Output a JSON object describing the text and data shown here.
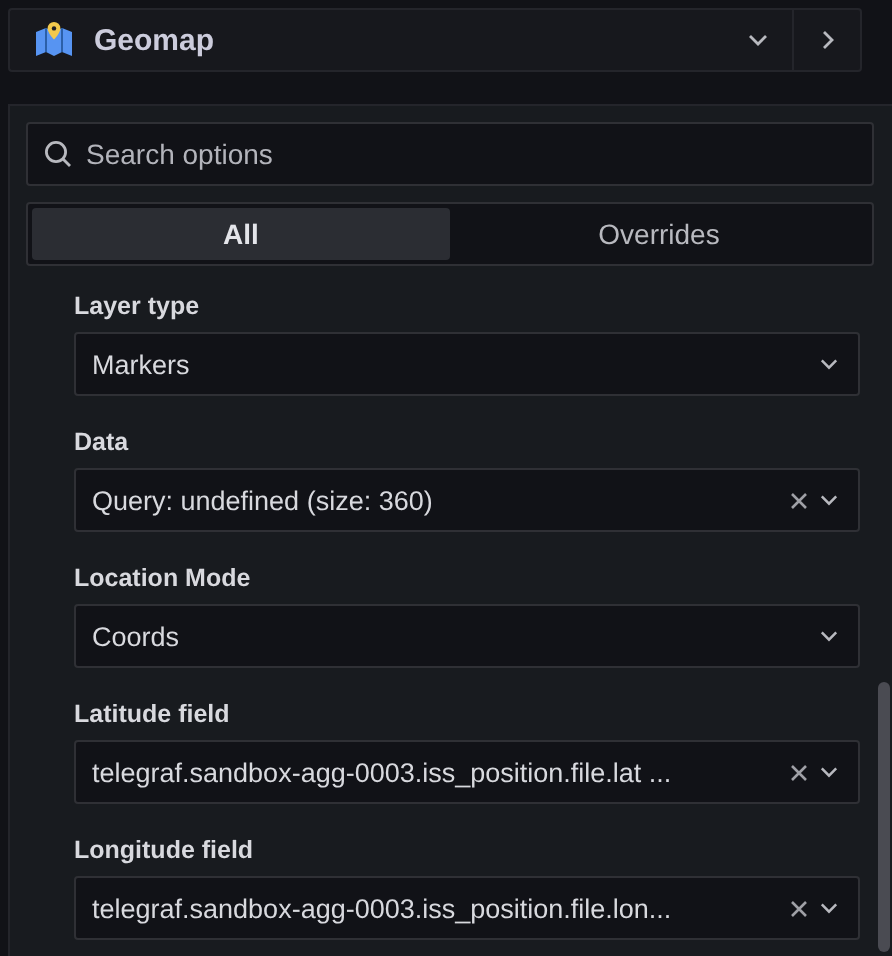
{
  "header": {
    "title": "Geomap"
  },
  "search": {
    "placeholder": "Search options"
  },
  "tabs": [
    {
      "label": "All",
      "selected": true
    },
    {
      "label": "Overrides",
      "selected": false
    }
  ],
  "fields": [
    {
      "label": "Layer type",
      "value": "Markers",
      "clearable": false
    },
    {
      "label": "Data",
      "value": "Query: undefined (size: 360)",
      "clearable": true
    },
    {
      "label": "Location Mode",
      "value": "Coords",
      "clearable": false
    },
    {
      "label": "Latitude field",
      "value": "telegraf.sandbox-agg-0003.iss_position.file.lat ...",
      "clearable": true
    },
    {
      "label": "Longitude field",
      "value": "telegraf.sandbox-agg-0003.iss_position.file.lon...",
      "clearable": true
    }
  ]
}
